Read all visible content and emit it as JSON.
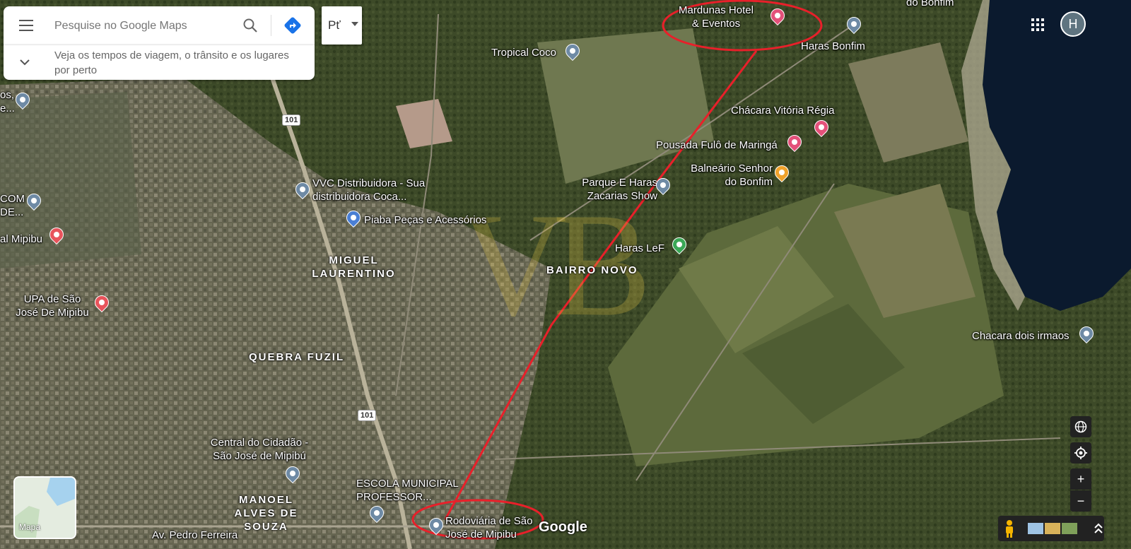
{
  "search": {
    "placeholder": "Pesquise no Google Maps",
    "hint": "Veja os tempos de viagem, o trânsito e os lugares por perto"
  },
  "lang_button": "Pť",
  "account_initial": "H",
  "layer_toggle_label": "Mapa",
  "brand": "Google",
  "watermark": "VB",
  "road_shields": [
    "101",
    "101"
  ],
  "neighborhoods": [
    "MIGUEL LAURENTINO",
    "BAIRRO NOVO",
    "QUEBRA FUZIL",
    "MANOEL ALVES DE SOUZA"
  ],
  "places": [
    {
      "name": "Mardunas Hotel & Eventos",
      "icon": "hotel-icon"
    },
    {
      "name": "Haras Bonfim",
      "icon": "pin-icon"
    },
    {
      "name": "Tropical Coco",
      "icon": "pin-icon"
    },
    {
      "name": "Chácara Vitória Régia",
      "icon": "hotel-icon"
    },
    {
      "name": "Pousada Fulô de Maringá",
      "icon": "hotel-icon"
    },
    {
      "name": "Balneário Senhor do Bonfim",
      "icon": "restaurant-icon"
    },
    {
      "name": "Parque E Haras Zacarias Show",
      "icon": "pin-icon"
    },
    {
      "name": "VVC Distribuidora - Sua distribuidora Coca...",
      "icon": "pin-icon"
    },
    {
      "name": "Piaba Peças e Acessórios",
      "icon": "shop-icon"
    },
    {
      "name": "Haras LeF",
      "icon": "park-icon"
    },
    {
      "name": "Chacara dois irmaos",
      "icon": "pin-icon"
    },
    {
      "name": "UPA de São José De Mipibu",
      "icon": "hospital-icon"
    },
    {
      "name": "al Mipibu",
      "icon": "hospital-icon"
    },
    {
      "name": "Central do Cidadão - São José de Mipibú",
      "icon": "pin-icon"
    },
    {
      "name": "ESCOLA MUNICIPAL PROFESSOR...",
      "icon": "school-icon"
    },
    {
      "name": "Rodoviária de São José de Mipibu",
      "icon": "pin-icon"
    },
    {
      "name": "Av. Pedro Ferreira",
      "icon": ""
    },
    {
      "name": "do Bonfim",
      "icon": ""
    },
    {
      "name": "COM DE...",
      "icon": "pin-icon"
    },
    {
      "name": "os, e...",
      "icon": "pin-icon"
    }
  ],
  "colors": {
    "route": "#e8202a",
    "pin": "#6e8aa5",
    "hotel": "#e4517a",
    "hospital": "#e8545c",
    "park": "#3aa856",
    "restaurant": "#f0a22b",
    "shop": "#4a7fd4",
    "water": "#0b1a2e"
  }
}
